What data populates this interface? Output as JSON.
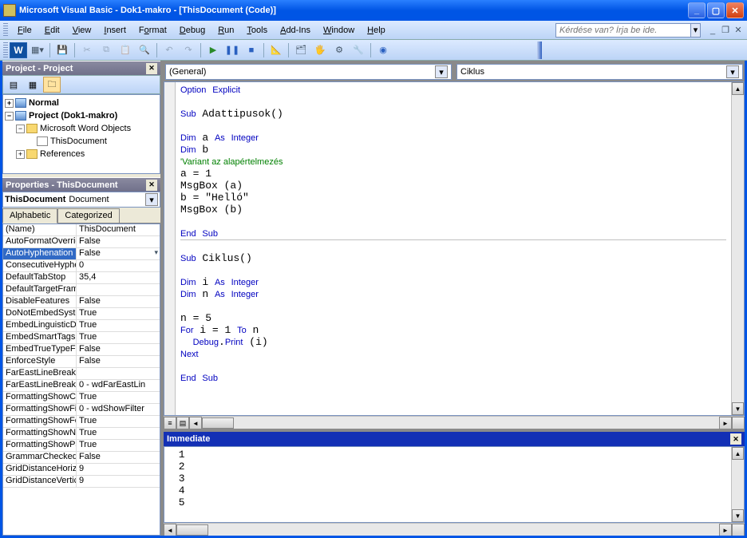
{
  "titlebar": {
    "title": "Microsoft Visual Basic - Dok1-makro - [ThisDocument (Code)]"
  },
  "menu": {
    "file": "File",
    "edit": "Edit",
    "view": "View",
    "insert": "Insert",
    "format": "Format",
    "debug": "Debug",
    "run": "Run",
    "tools": "Tools",
    "addins": "Add-Ins",
    "window": "Window",
    "help": "Help",
    "question_placeholder": "Kérdése van? Írja be ide."
  },
  "project_panel": {
    "title": "Project - Project",
    "items": {
      "normal": "Normal",
      "project": "Project (Dok1-makro)",
      "word_objects": "Microsoft Word Objects",
      "this_document": "ThisDocument",
      "references": "References"
    }
  },
  "properties_panel": {
    "title": "Properties - ThisDocument",
    "object_name": "ThisDocument",
    "object_type": "Document",
    "tabs": {
      "alphabetic": "Alphabetic",
      "categorized": "Categorized"
    },
    "rows": [
      {
        "name": "(Name)",
        "value": "ThisDocument"
      },
      {
        "name": "AutoFormatOverride",
        "value": "False"
      },
      {
        "name": "AutoHyphenation",
        "value": "False",
        "selected": true
      },
      {
        "name": "ConsecutiveHyphe",
        "value": "0"
      },
      {
        "name": "DefaultTabStop",
        "value": "35,4"
      },
      {
        "name": "DefaultTargetFrame",
        "value": ""
      },
      {
        "name": "DisableFeatures",
        "value": "False"
      },
      {
        "name": "DoNotEmbedSyste",
        "value": "True"
      },
      {
        "name": "EmbedLinguisticDa",
        "value": "True"
      },
      {
        "name": "EmbedSmartTags",
        "value": "True"
      },
      {
        "name": "EmbedTrueTypeFo",
        "value": "False"
      },
      {
        "name": "EnforceStyle",
        "value": "False"
      },
      {
        "name": "FarEastLineBreakL",
        "value": ""
      },
      {
        "name": "FarEastLineBreakL",
        "value": "0 - wdFarEastLin"
      },
      {
        "name": "FormattingShowCl",
        "value": "True"
      },
      {
        "name": "FormattingShowFil",
        "value": "0 - wdShowFilter"
      },
      {
        "name": "FormattingShowFo",
        "value": "True"
      },
      {
        "name": "FormattingShowNu",
        "value": "True"
      },
      {
        "name": "FormattingShowPa",
        "value": "True"
      },
      {
        "name": "GrammarChecked",
        "value": "False"
      },
      {
        "name": "GridDistanceHorizo",
        "value": "9"
      },
      {
        "name": "GridDistanceVertic",
        "value": "9"
      }
    ]
  },
  "code": {
    "object_combo": "(General)",
    "proc_combo": "Ciklus",
    "block1": "Option Explicit\n\nSub Adattipusok()\n\nDim a As Integer\nDim b\n'Variant az alapértelmezés\na = 1\nMsgBox (a)\nb = \"Helló\"\nMsgBox (b)\n\nEnd Sub",
    "block2": "\nSub Ciklus()\n\nDim i As Integer\nDim n As Integer\n\nn = 5\nFor i = 1 To n\n  Debug.Print (i)\nNext\n\nEnd Sub"
  },
  "immediate": {
    "title": "Immediate",
    "output": " 1 \n 2 \n 3 \n 4 \n 5 "
  }
}
